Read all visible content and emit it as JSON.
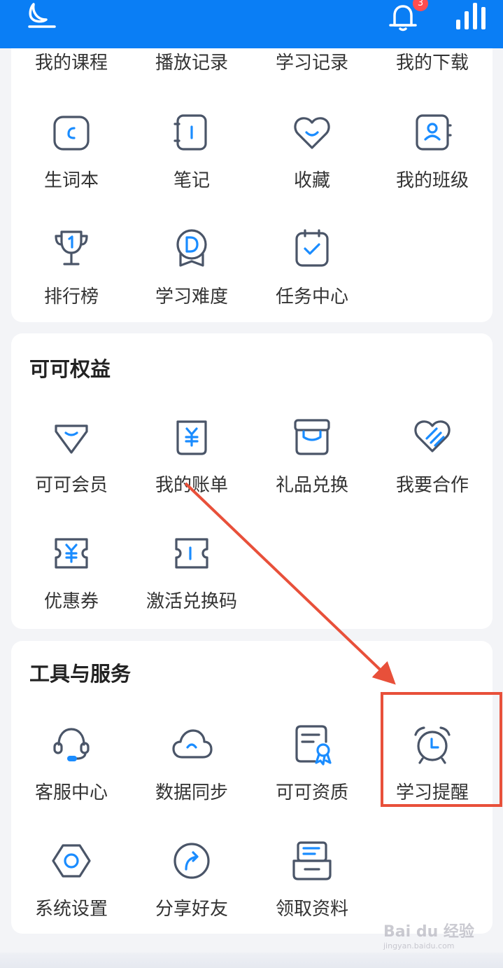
{
  "header": {
    "badge_count": "3",
    "icons": [
      "moon-icon",
      "bell-icon",
      "stats-bars-icon"
    ]
  },
  "my_section": {
    "top_row": [
      "我的课程",
      "播放记录",
      "学习记录",
      "我的下载"
    ],
    "items": [
      {
        "label": "生词本",
        "icon": "vocab-book-icon"
      },
      {
        "label": "笔记",
        "icon": "notebook-icon"
      },
      {
        "label": "收藏",
        "icon": "heart-icon"
      },
      {
        "label": "我的班级",
        "icon": "class-contact-icon"
      },
      {
        "label": "排行榜",
        "icon": "trophy-icon"
      },
      {
        "label": "学习难度",
        "icon": "difficulty-medal-icon"
      },
      {
        "label": "任务中心",
        "icon": "task-clipboard-icon"
      }
    ]
  },
  "benefits": {
    "title": "可可权益",
    "items": [
      {
        "label": "可可会员",
        "icon": "diamond-icon"
      },
      {
        "label": "我的账单",
        "icon": "bill-yen-icon"
      },
      {
        "label": "礼品兑换",
        "icon": "gift-box-icon"
      },
      {
        "label": "我要合作",
        "icon": "handshake-heart-icon"
      },
      {
        "label": "优惠券",
        "icon": "coupon-yen-icon"
      },
      {
        "label": "激活兑换码",
        "icon": "ticket-icon"
      }
    ]
  },
  "tools": {
    "title": "工具与服务",
    "items": [
      {
        "label": "客服中心",
        "icon": "headset-icon"
      },
      {
        "label": "数据同步",
        "icon": "cloud-icon"
      },
      {
        "label": "可可资质",
        "icon": "certificate-icon"
      },
      {
        "label": "学习提醒",
        "icon": "alarm-clock-icon"
      },
      {
        "label": "系统设置",
        "icon": "hexagon-settings-icon"
      },
      {
        "label": "分享好友",
        "icon": "share-arrow-icon"
      },
      {
        "label": "领取资料",
        "icon": "inbox-tray-icon"
      }
    ]
  },
  "annotation": {
    "color": "#e8503a",
    "highlight": "学习提醒"
  },
  "watermark": {
    "text": "Bai du 经验",
    "sub": "jingyan.baidu.com"
  }
}
